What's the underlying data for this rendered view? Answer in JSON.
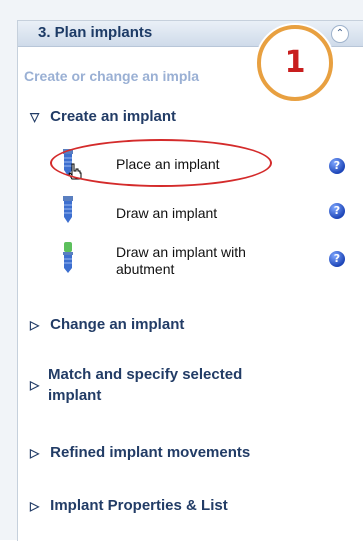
{
  "panel": {
    "title": "3. Plan implants",
    "subtitle": "Create or change an impla",
    "collapse_icon": "chevron-double-up-icon"
  },
  "badge": {
    "label": "1"
  },
  "groups": [
    {
      "label": "Create an implant",
      "expanded": true,
      "items": [
        {
          "label": "Place an implant",
          "icon": "implant-blue-icon",
          "help": "?"
        },
        {
          "label": "Draw an implant",
          "icon": "implant-blue-icon",
          "help": "?"
        },
        {
          "label_line1": "Draw an implant with",
          "label_line2": "abutment",
          "icon": "implant-green-abutment-icon",
          "help": "?"
        }
      ]
    },
    {
      "label": "Change an implant",
      "expanded": false
    },
    {
      "label_line1": "Match and specify selected",
      "label_line2": "implant",
      "expanded": false
    },
    {
      "label": "Refined implant movements",
      "expanded": false
    },
    {
      "label": "Implant Properties & List",
      "expanded": false
    }
  ],
  "colors": {
    "header_text": "#1d3b66",
    "callout_red": "#d42b2b",
    "badge_ring": "#e8a040"
  }
}
